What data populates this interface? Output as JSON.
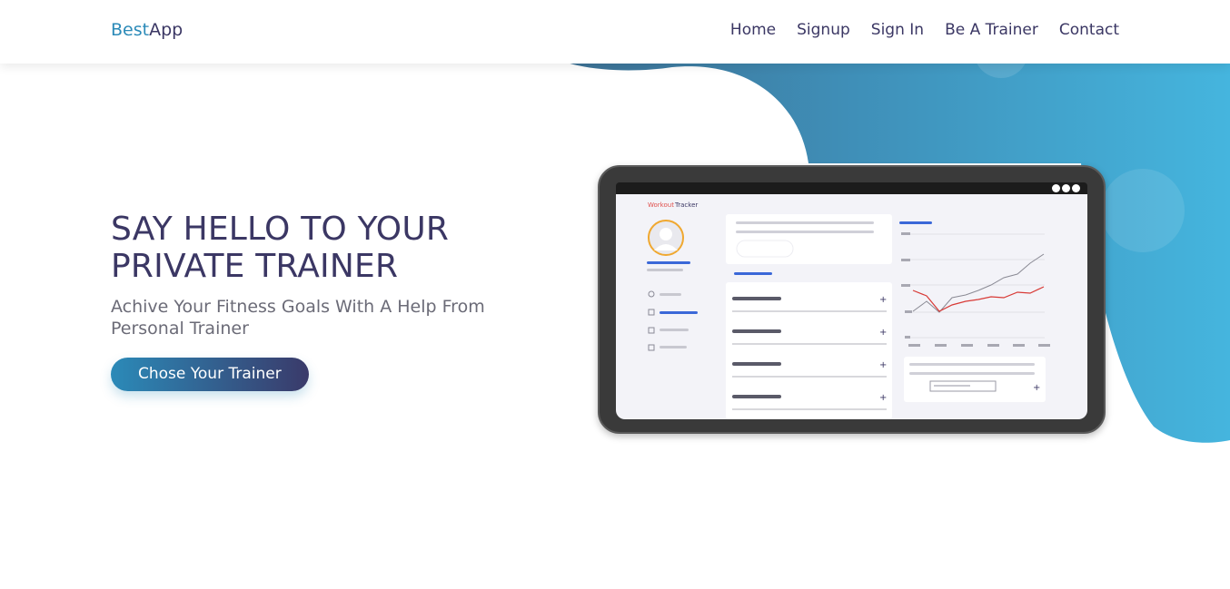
{
  "brand": {
    "part1": "Best",
    "part2": "App"
  },
  "nav": {
    "items": [
      "Home",
      "Signup",
      "Sign In",
      "Be A Trainer",
      "Contact"
    ]
  },
  "hero": {
    "title": "SAY HELLO TO YOUR PRIVATE TRAINER",
    "subtitle": "Achive Your Fitness Goals With A Help From Personal Trainer",
    "cta_label": "Chose Your Trainer"
  },
  "mockup": {
    "app_name_part1": "Workout",
    "app_name_part2": "Tracker"
  },
  "colors": {
    "brand_accent": "#2b8ab8",
    "text_dark": "#3b3764",
    "blob_start": "#3d84a8",
    "blob_end": "#45b5de"
  }
}
